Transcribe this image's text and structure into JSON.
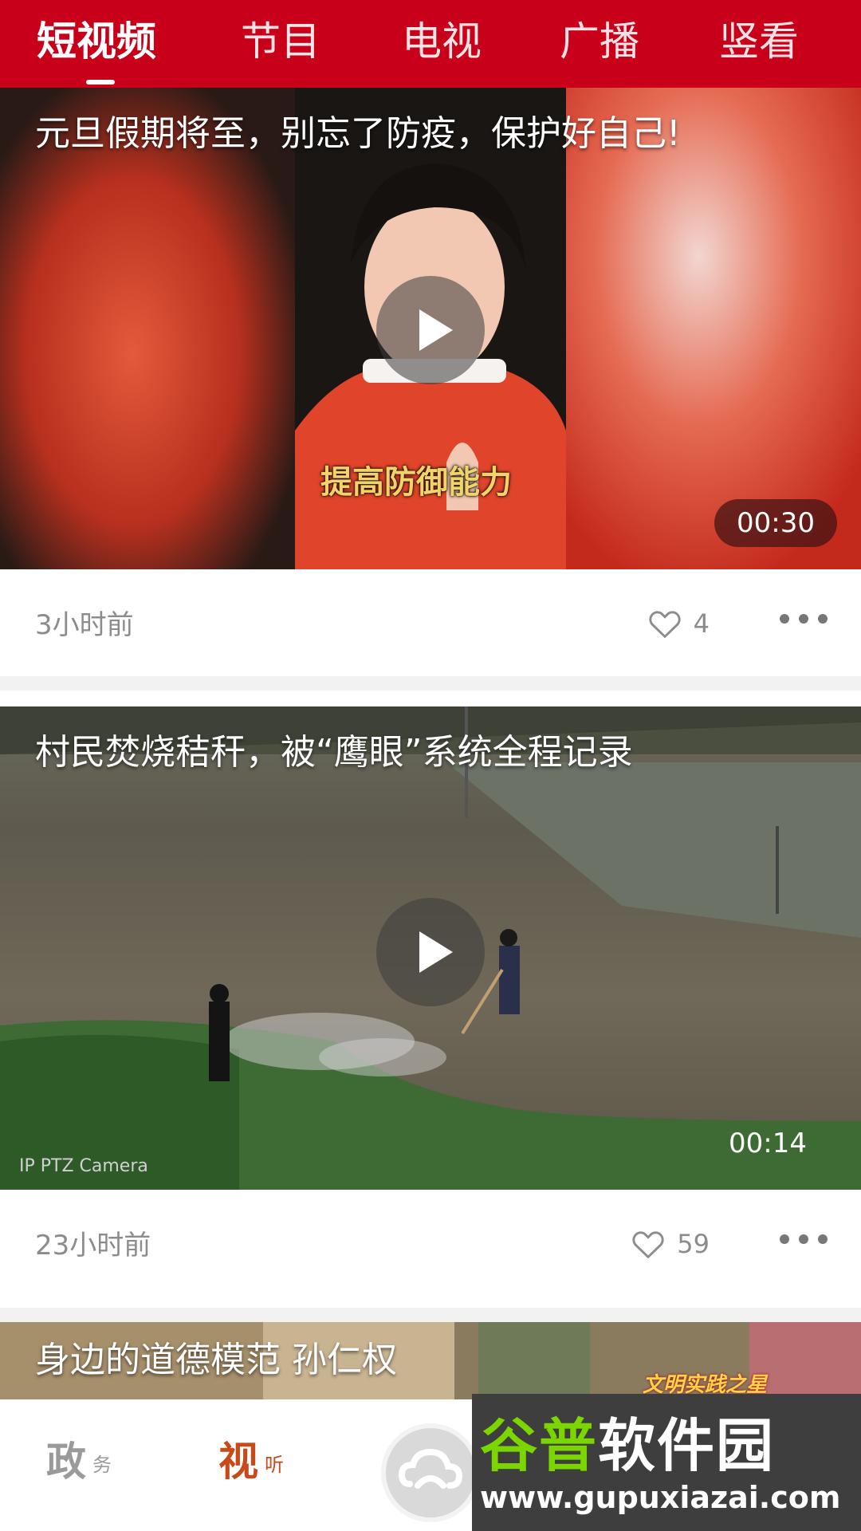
{
  "header": {
    "tabs": [
      {
        "label": "短视频",
        "active": true
      },
      {
        "label": "节目",
        "active": false
      },
      {
        "label": "电视",
        "active": false
      },
      {
        "label": "广播",
        "active": false
      },
      {
        "label": "竖看",
        "active": false
      }
    ],
    "color": "#c8001a"
  },
  "feed": [
    {
      "title": "元旦假期将至，别忘了防疫，保护好自己!",
      "caption": "提高防御能力",
      "duration": "00:30",
      "time": "3小时前",
      "likes": "4"
    },
    {
      "title": "村民焚烧秸秆，被“鹰眼”系统全程记录",
      "duration": "00:14",
      "time": "23小时前",
      "likes": "59",
      "overlay_text": "IP PTZ Camera"
    },
    {
      "title": "身边的道德模范  孙仁权",
      "badge": "文明实践之星"
    }
  ],
  "bottom_nav": {
    "items": [
      {
        "label": "政",
        "sub": "务"
      },
      {
        "label": "视",
        "sub": "听"
      }
    ]
  },
  "watermark": {
    "title_part1": "谷普",
    "title_part2": "软件园",
    "url": "www.gupuxiazai.com"
  }
}
